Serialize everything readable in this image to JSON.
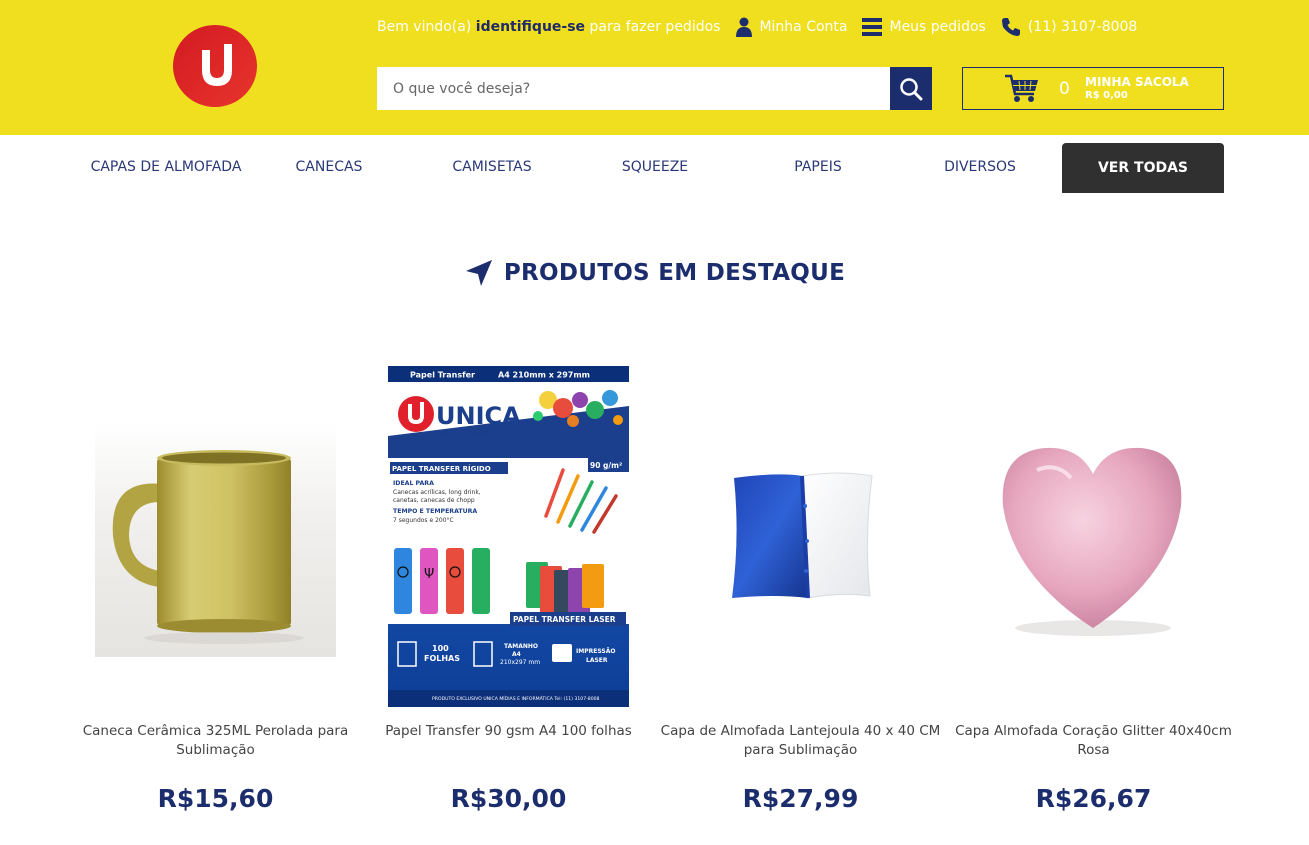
{
  "header": {
    "welcome_prefix": "Bem vindo(a)",
    "identify_link": "identifique-se",
    "welcome_suffix": "para fazer pedidos",
    "my_account": "Minha Conta",
    "my_orders": "Meus pedidos",
    "phone": "(11) 3107-8008",
    "search_placeholder": "O que você deseja?",
    "cart_count": "0",
    "cart_label": "MINHA SACOLA",
    "cart_total": "R$ 0,00",
    "colors": {
      "background": "#f0df1e",
      "primary": "#1c2d6e",
      "logo": "#e0202a"
    }
  },
  "nav": {
    "items": [
      {
        "label": "CAPAS DE ALMOFADA"
      },
      {
        "label": "CANECAS"
      },
      {
        "label": "CAMISETAS"
      },
      {
        "label": "SQUEEZE"
      },
      {
        "label": "PAPEIS"
      },
      {
        "label": "DIVERSOS"
      }
    ],
    "all_label": "VER TODAS"
  },
  "section": {
    "title": "PRODUTOS EM DESTAQUE",
    "icon": "location-arrow-icon"
  },
  "products": [
    {
      "name": "Caneca Cerâmica 325ML Perolada para Sublimação",
      "price": "R$15,60",
      "image": "gold-mug"
    },
    {
      "name": "Papel Transfer 90 gsm A4 100 folhas",
      "price": "R$30,00",
      "image": "transfer-paper-package"
    },
    {
      "name": "Capa de Almofada Lantejoula 40 x 40 CM para Sublimação",
      "price": "R$27,99",
      "image": "sequin-pillow"
    },
    {
      "name": "Capa Almofada Coração Glitter 40x40cm Rosa",
      "price": "R$26,67",
      "image": "pink-heart-pillow"
    }
  ],
  "paper_package": {
    "header_left": "Papel Transfer",
    "header_right": "A4 210mm x 297mm",
    "brand": "UNICA",
    "brand_sub": "MÍDIAS E INFORMÁTICA",
    "gsm": "90 g/m²",
    "heading": "PAPEL TRANSFER RÍGIDO",
    "ideal_para": "IDEAL PARA",
    "ideal_text_1": "Canecas acrílicas, long drink,",
    "ideal_text_2": "canetas, canecas de chopp",
    "temp_label": "TEMPO E TEMPERATURA",
    "temp_text": "7 segundos e 200°C",
    "laser_label": "PAPEL TRANSFER LASER",
    "feat1_num": "100",
    "feat1_txt": "FOLHAS",
    "feat2_t1": "TAMANHO",
    "feat2_t2": "A4",
    "feat2_t3": "210x297 mm",
    "feat3_t1": "IMPRESSÃO",
    "feat3_t2": "LASER",
    "footer": "PRODUTO EXCLUSIVO UNICA MÍDIAS E INFORMÁTICA  Tel: (11) 3107-8008"
  }
}
